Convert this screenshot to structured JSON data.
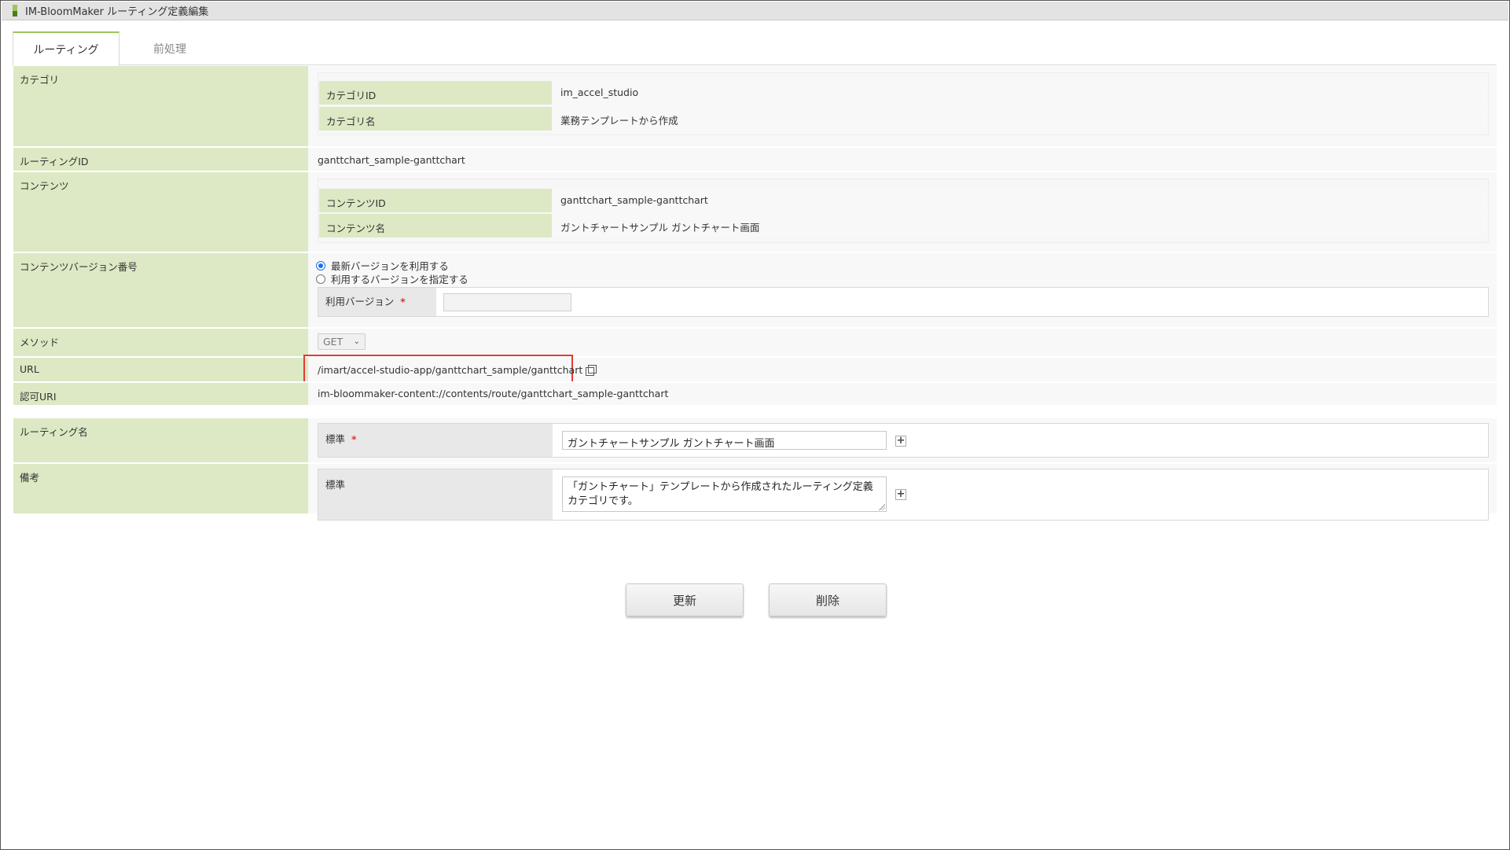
{
  "window": {
    "title": "IM-BloomMaker ルーティング定義編集"
  },
  "tabs": [
    {
      "label": "ルーティング",
      "active": true
    },
    {
      "label": "前処理",
      "active": false
    }
  ],
  "category": {
    "label": "カテゴリ",
    "id_label": "カテゴリID",
    "id_value": "im_accel_studio",
    "name_label": "カテゴリ名",
    "name_value": "業務テンプレートから作成"
  },
  "routing_id": {
    "label": "ルーティングID",
    "value": "ganttchart_sample-ganttchart"
  },
  "contents": {
    "label": "コンテンツ",
    "id_label": "コンテンツID",
    "id_value": "ganttchart_sample-ganttchart",
    "name_label": "コンテンツ名",
    "name_value": "ガントチャートサンプル ガントチャート画面"
  },
  "version": {
    "label": "コンテンツバージョン番号",
    "option_latest": "最新バージョンを利用する",
    "option_specify": "利用するバージョンを指定する",
    "use_version_label": "利用バージョン",
    "required_mark": "*",
    "use_version_value": "",
    "selected": "latest"
  },
  "method": {
    "label": "メソッド",
    "value": "GET"
  },
  "url": {
    "label": "URL",
    "value": "/imart/accel-studio-app/ganttchart_sample/ganttchart"
  },
  "auth_uri": {
    "label": "認可URI",
    "value": "im-bloommaker-content://contents/route/ganttchart_sample-ganttchart"
  },
  "routing_name": {
    "label": "ルーティング名",
    "locale_label": "標準",
    "required_mark": "*",
    "value": "ガントチャートサンプル ガントチャート画面",
    "add_symbol": "+"
  },
  "remarks": {
    "label": "備考",
    "locale_label": "標準",
    "value": "「ガントチャート」テンプレートから作成されたルーティング定義カテゴリです。",
    "add_symbol": "+"
  },
  "buttons": {
    "update": "更新",
    "delete": "削除"
  },
  "colors": {
    "label_bg": "#dce9c4",
    "highlight": "#e53935",
    "radio": "#1a73e8"
  }
}
